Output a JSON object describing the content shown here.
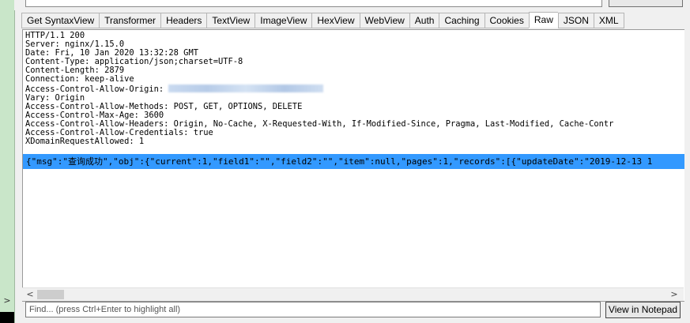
{
  "tabs": [
    {
      "label": "Get SyntaxView"
    },
    {
      "label": "Transformer"
    },
    {
      "label": "Headers"
    },
    {
      "label": "TextView"
    },
    {
      "label": "ImageView"
    },
    {
      "label": "HexView"
    },
    {
      "label": "WebView"
    },
    {
      "label": "Auth"
    },
    {
      "label": "Caching"
    },
    {
      "label": "Cookies"
    },
    {
      "label": "Raw",
      "active": true
    },
    {
      "label": "JSON"
    },
    {
      "label": "XML"
    }
  ],
  "response": {
    "status_line": "HTTP/1.1 200",
    "headers": [
      "Server: nginx/1.15.0",
      "Date: Fri, 10 Jan 2020 13:32:28 GMT",
      "Content-Type: application/json;charset=UTF-8",
      "Content-Length: 2879",
      "Connection: keep-alive"
    ],
    "allow_origin_label": "Access-Control-Allow-Origin: ",
    "headers_after": [
      "Vary: Origin",
      "Access-Control-Allow-Methods: POST, GET, OPTIONS, DELETE",
      "Access-Control-Max-Age: 3600",
      "Access-Control-Allow-Headers: Origin, No-Cache, X-Requested-With, If-Modified-Since, Pragma, Last-Modified, Cache-Contr",
      "Access-Control-Allow-Credentials: true",
      "XDomainRequestAllowed: 1"
    ],
    "body": "{\"msg\":\"查询成功\",\"obj\":{\"current\":1,\"field1\":\"\",\"field2\":\"\",\"item\":null,\"pages\":1,\"records\":[{\"updateDate\":\"2019-12-13 1"
  },
  "find": {
    "placeholder": "Find... (press Ctrl+Enter to highlight all)"
  },
  "view_in_notepad_label": "View in Notepad"
}
